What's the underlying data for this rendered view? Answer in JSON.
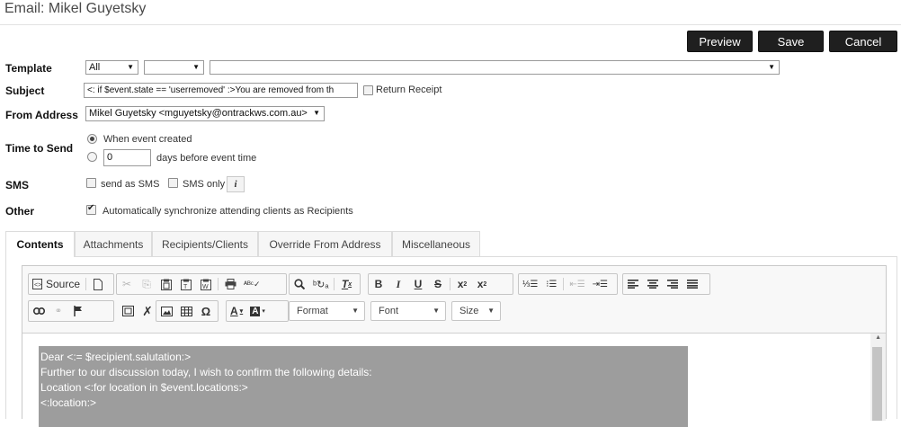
{
  "header": {
    "title": "Email: Mikel Guyetsky",
    "buttons": {
      "preview": "Preview",
      "save": "Save",
      "cancel": "Cancel"
    }
  },
  "form": {
    "template": {
      "label": "Template",
      "filter_value": "All",
      "sub_value": "",
      "template_value": ""
    },
    "subject": {
      "label": "Subject",
      "value": "<: if $event.state == 'userremoved' :>You are removed from th",
      "return_receipt_label": "Return Receipt",
      "return_receipt_checked": false
    },
    "from_address": {
      "label": "From Address",
      "value": "Mikel Guyetsky <mguyetsky@ontrackws.com.au>"
    },
    "time_to_send": {
      "label": "Time to Send",
      "option_created": "When event created",
      "option_before_value": "0",
      "option_before_suffix": "days before event time",
      "selected": "created"
    },
    "sms": {
      "label": "SMS",
      "send_as_sms": "send as SMS",
      "sms_only": "SMS only",
      "info": "i"
    },
    "other": {
      "label": "Other",
      "sync_label": "Automatically synchronize attending clients as Recipients",
      "sync_checked": true
    }
  },
  "tabs": [
    {
      "label": "Contents",
      "active": true
    },
    {
      "label": "Attachments",
      "active": false
    },
    {
      "label": "Recipients/Clients",
      "active": false
    },
    {
      "label": "Override From Address",
      "active": false
    },
    {
      "label": "Miscellaneous",
      "active": false
    }
  ],
  "editor": {
    "source_label": "Source",
    "format_label": "Format",
    "font_label": "Font",
    "size_label": "Size",
    "content_lines": [
      "Dear <:= $recipient.salutation:>",
      "Further to our discussion today, I wish to confirm the following details:",
      "Location <:for location in $event.locations:>",
      "<:location:>"
    ]
  },
  "icons": {
    "dropdown": "▼",
    "scroll_up": "▲"
  }
}
